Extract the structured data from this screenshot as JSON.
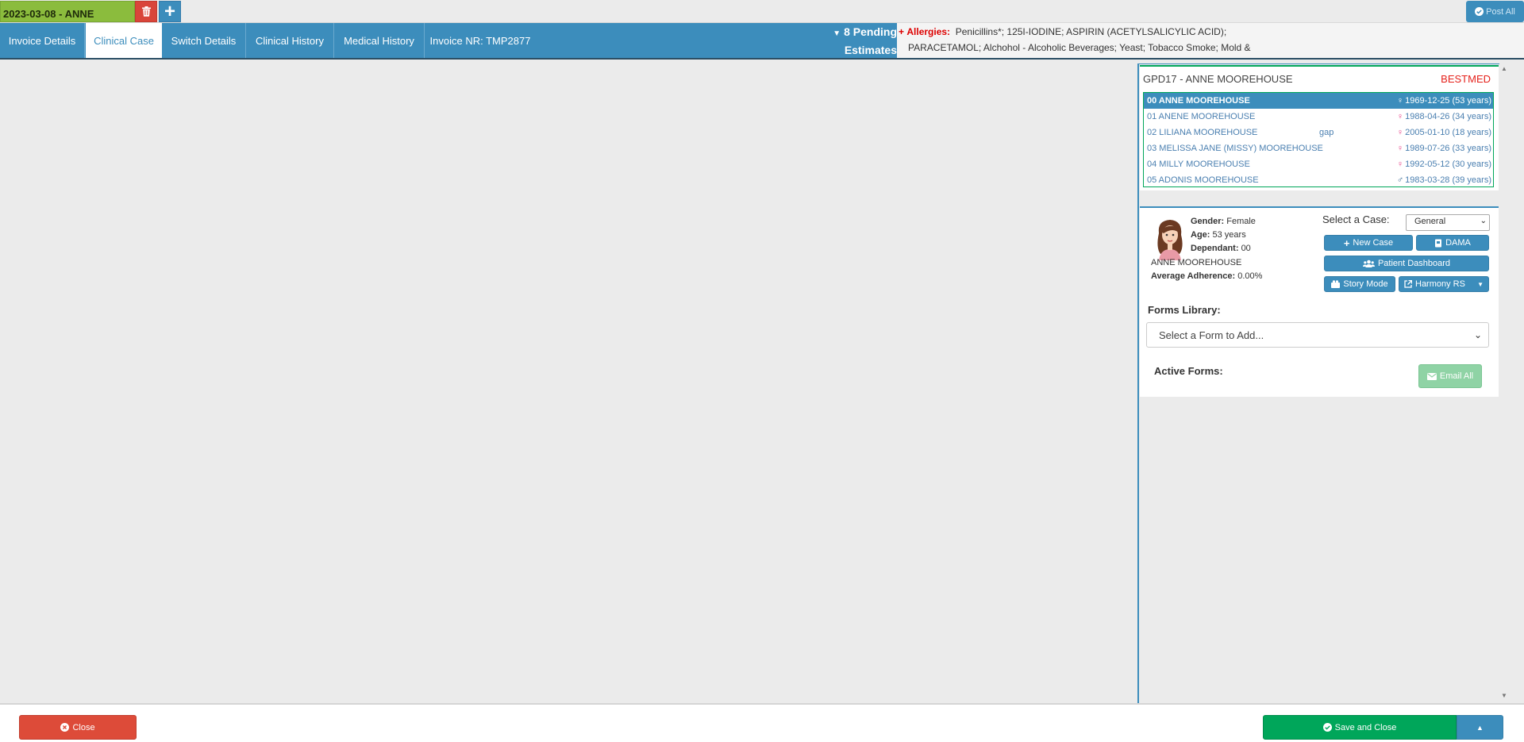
{
  "topbar": {
    "encounter_label": "2023-03-08 - ANNE",
    "post_all_label": "Post All"
  },
  "nav": {
    "tabs": [
      {
        "label": "Invoice Details"
      },
      {
        "label": "Clinical Case"
      },
      {
        "label": "Switch Details"
      },
      {
        "label": "Clinical History"
      },
      {
        "label": "Medical History"
      },
      {
        "label": "Invoice NR: TMP2877"
      }
    ],
    "active_tab": "Clinical Case",
    "pending_line1": "8 Pending",
    "pending_line2": "Estimates",
    "allergies_label": "Allergies:",
    "allergies_line1": "Penicillins*; 125I-IODINE; ASPIRIN (ACETYLSALICYLIC ACID);",
    "allergies_line2": "PARACETAMOL; Alchohol - Alcoholic Beverages; Yeast; Tobacco Smoke; Mold &"
  },
  "family": {
    "title": "GPD17 - ANNE MOOREHOUSE",
    "scheme": "BESTMED",
    "members": [
      {
        "name": "00 ANNE MOOREHOUSE",
        "note": "",
        "dob": "1969-12-25 (53 years)",
        "sex": "female",
        "selected": true
      },
      {
        "name": "01 ANENE MOOREHOUSE",
        "note": "",
        "dob": "1988-04-26 (34 years)",
        "sex": "female",
        "selected": false
      },
      {
        "name": "02 LILIANA MOOREHOUSE",
        "note": "gap",
        "dob": "2005-01-10 (18 years)",
        "sex": "female",
        "selected": false
      },
      {
        "name": "03 MELISSA JANE (MISSY) MOOREHOUSE",
        "note": "",
        "dob": "1989-07-26 (33 years)",
        "sex": "female",
        "selected": false
      },
      {
        "name": "04 MILLY MOOREHOUSE",
        "note": "",
        "dob": "1992-05-12 (30 years)",
        "sex": "female",
        "selected": false
      },
      {
        "name": "05 ADONIS MOOREHOUSE",
        "note": "",
        "dob": "1983-03-28 (39 years)",
        "sex": "male",
        "selected": false
      }
    ]
  },
  "patient": {
    "gender_label": "Gender:",
    "gender": "Female",
    "age_label": "Age:",
    "age": "53 years",
    "dependant_label": "Dependant:",
    "dependant": "00",
    "name": "ANNE MOOREHOUSE",
    "adherence_label": "Average Adherence:",
    "adherence": "0.00%",
    "select_case_label": "Select a Case:",
    "case_value": "General",
    "new_case_label": "New Case",
    "dama_label": "DAMA",
    "dashboard_label": "Patient Dashboard",
    "story_mode_label": "Story Mode",
    "harmony_label": "Harmony RS",
    "forms_library_label": "Forms Library:",
    "form_placeholder": "Select a Form to Add...",
    "active_forms_label": "Active Forms:",
    "email_all_label": "Email All"
  },
  "footer": {
    "close_label": "Close",
    "save_label": "Save and Close"
  },
  "colors": {
    "primary": "#3c8dbc",
    "success": "#00a65a",
    "danger": "#dd4b39",
    "encounter_green": "#8bbc3d",
    "scheme_red": "#e5211b"
  }
}
